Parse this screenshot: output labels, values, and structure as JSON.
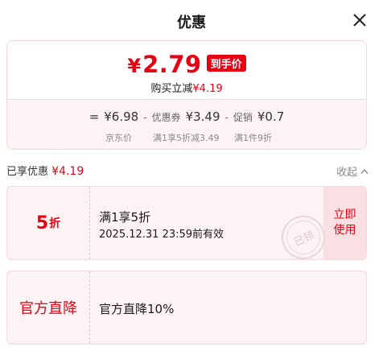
{
  "header": {
    "title": "优惠"
  },
  "price": {
    "currency": "¥",
    "amount": "2.79",
    "tag": "到手价",
    "sub_prefix": "购买立减",
    "sub_amount": "¥4.19"
  },
  "breakdown": {
    "equals": "=",
    "base": "¥6.98",
    "minus1": "-",
    "coupon_label": "优惠券",
    "coupon_value": "¥3.49",
    "minus2": "-",
    "promo_label": "促销",
    "promo_value": "¥0.7",
    "label_base": "京东价",
    "label_coupon": "满1享5折减3.49",
    "label_promo": "满1件9折"
  },
  "enjoyed": {
    "prefix": "已享优惠",
    "amount": "¥4.19"
  },
  "collapse": {
    "label": "收起"
  },
  "coupons": [
    {
      "discount_num": "5",
      "discount_unit": "折",
      "title": "满1享5折",
      "validity": "2025.12.31 23:59前有效",
      "action_line1": "立即",
      "action_line2": "使用",
      "stamp": "已领"
    },
    {
      "left_label": "官方直降",
      "title": "官方直降10%"
    }
  ],
  "icons": {
    "close": "close-icon",
    "collapse": "chevron-up-icon"
  },
  "colors": {
    "accent": "#e60012",
    "card_bg": "#fdf3f4",
    "border": "#f4d8da"
  }
}
